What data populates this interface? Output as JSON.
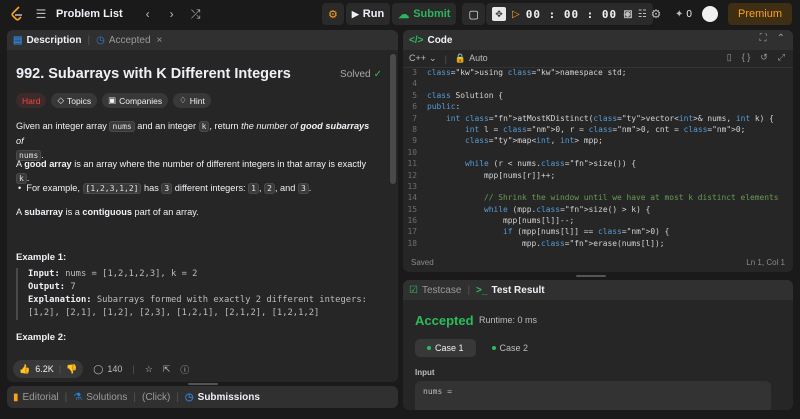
{
  "topbar": {
    "title": "Problem List",
    "run_label": "Run",
    "submit_label": "Submit",
    "timer": "00 : 00 : 00",
    "coins": "0",
    "premium_label": "Premium"
  },
  "left": {
    "tabs": [
      "Description",
      "Accepted"
    ],
    "title": "992. Subarrays with K Different Integers",
    "status": "Solved",
    "tags": [
      "Hard",
      "Topics",
      "Companies",
      "Hint"
    ],
    "p1a": "Given an integer array ",
    "p1code1": "nums",
    "p1b": " and an integer ",
    "p1code2": "k",
    "p1c": ", return ",
    "p1i1": "the number of ",
    "p1bold": "good subarrays",
    "p1i2": " of",
    "p1code3": "nums",
    "p1end": ".",
    "p2a": "A ",
    "p2bold": "good array",
    "p2b": " is an array where the number of different integers in that array is exactly ",
    "p2code": "k",
    "p2end": ".",
    "bullet_a": "For example, ",
    "bullet_code1": "[1,2,3,1,2]",
    "bullet_b": " has ",
    "bullet_code2": "3",
    "bullet_c": " different integers: ",
    "bullet_code3": "1",
    "bullet_d": ", ",
    "bullet_code4": "2",
    "bullet_e": ", and ",
    "bullet_code5": "3",
    "bullet_end": ".",
    "p3a": "A ",
    "p3bold1": "subarray",
    "p3b": " is a ",
    "p3bold2": "contiguous",
    "p3c": " part of an array.",
    "ex1_title": "Example 1:",
    "ex1_input_label": "Input:",
    "ex1_input": " nums = [1,2,1,2,3], k = 2",
    "ex1_output_label": "Output:",
    "ex1_output": " 7",
    "ex1_expl_label": "Explanation:",
    "ex1_expl": " Subarrays formed with exactly 2 different integers:",
    "ex1_expl2": "[1,2], [2,1], [1,2], [2,3], [1,2,1], [2,1,2], [1,2,1,2]",
    "ex2_title": "Example 2:",
    "likes": "6.2K",
    "comments": "140"
  },
  "bottom_tabs": [
    "Editorial",
    "Solutions",
    "(Click)",
    "Submissions"
  ],
  "code": {
    "tab_label": "Code",
    "language": "C++",
    "mode": "Auto",
    "lines": [
      {
        "n": "3",
        "t": "using namespace std;"
      },
      {
        "n": "4",
        "t": ""
      },
      {
        "n": "5",
        "t": "class Solution {"
      },
      {
        "n": "6",
        "t": "public:"
      },
      {
        "n": "7",
        "t": "    int atMostKDistinct(vector<int>& nums, int k) {"
      },
      {
        "n": "8",
        "t": "        int l = 0, r = 0, cnt = 0;"
      },
      {
        "n": "9",
        "t": "        map<int, int> mpp;"
      },
      {
        "n": "10",
        "t": ""
      },
      {
        "n": "11",
        "t": "        while (r < nums.size()) {"
      },
      {
        "n": "12",
        "t": "            mpp[nums[r]]++;"
      },
      {
        "n": "13",
        "t": ""
      },
      {
        "n": "14",
        "t": "            // Shrink the window until we have at most k distinct elements"
      },
      {
        "n": "15",
        "t": "            while (mpp.size() > k) {"
      },
      {
        "n": "16",
        "t": "                mpp[nums[l]]--;"
      },
      {
        "n": "17",
        "t": "                if (mpp[nums[l]] == 0) {"
      },
      {
        "n": "18",
        "t": "                    mpp.erase(nums[l]);"
      }
    ],
    "saved": "Saved",
    "cursor": "Ln 1, Col 1"
  },
  "test": {
    "tabs": [
      "Testcase",
      "Test Result"
    ],
    "result": "Accepted",
    "runtime": "Runtime: 0 ms",
    "cases": [
      "Case 1",
      "Case 2"
    ],
    "input_label": "Input",
    "input_value": "nums ="
  }
}
